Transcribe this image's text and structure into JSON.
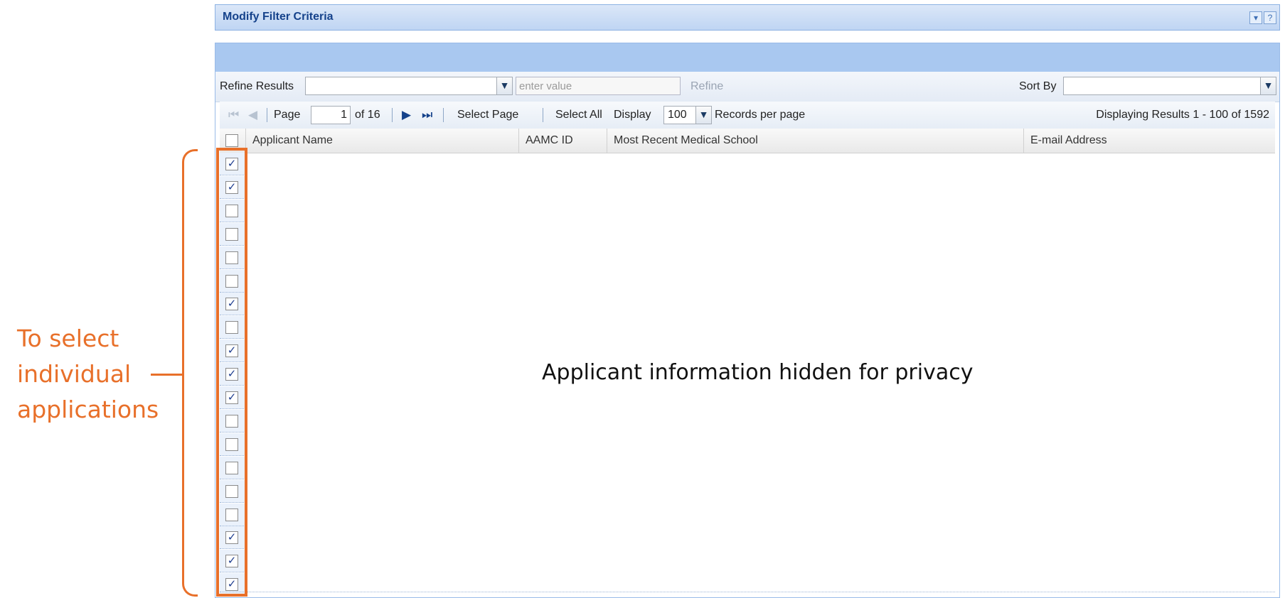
{
  "annotation": {
    "lines": [
      "To select",
      "individual",
      "applications"
    ],
    "color": "#e8702a"
  },
  "filter_panel": {
    "title": "Modify Filter Criteria",
    "collapse_icon": "chevron-down-icon",
    "help_icon": "help-icon",
    "help_glyph": "?",
    "collapse_glyph": "▾"
  },
  "refine": {
    "label": "Refine Results",
    "field_value": "",
    "value_placeholder": "enter value",
    "button": "Refine",
    "sort_label": "Sort By",
    "sort_value": ""
  },
  "paging": {
    "page_label": "Page",
    "current_page": "1",
    "of_pages": "of 16",
    "select_page": "Select Page",
    "select_all": "Select All",
    "display_label": "Display",
    "records_per_page": "100",
    "records_label": "Records per page",
    "displaying": "Displaying Results 1 - 100 of 1592",
    "icons": {
      "first": "first-page-icon",
      "prev": "previous-page-icon",
      "next": "next-page-icon",
      "last": "last-page-icon"
    }
  },
  "grid": {
    "columns": [
      "Applicant Name",
      "AAMC ID",
      "Most Recent Medical School",
      "E-mail Address"
    ],
    "header_checked": false,
    "rows_checked": [
      true,
      true,
      false,
      false,
      false,
      false,
      true,
      false,
      true,
      true,
      true,
      false,
      false,
      false,
      false,
      false,
      true,
      true,
      true
    ],
    "privacy_note": "Applicant information hidden for privacy"
  },
  "colors": {
    "highlight": "#e8702a",
    "header_blue": "#a9c8f0",
    "title_text": "#15428b"
  }
}
